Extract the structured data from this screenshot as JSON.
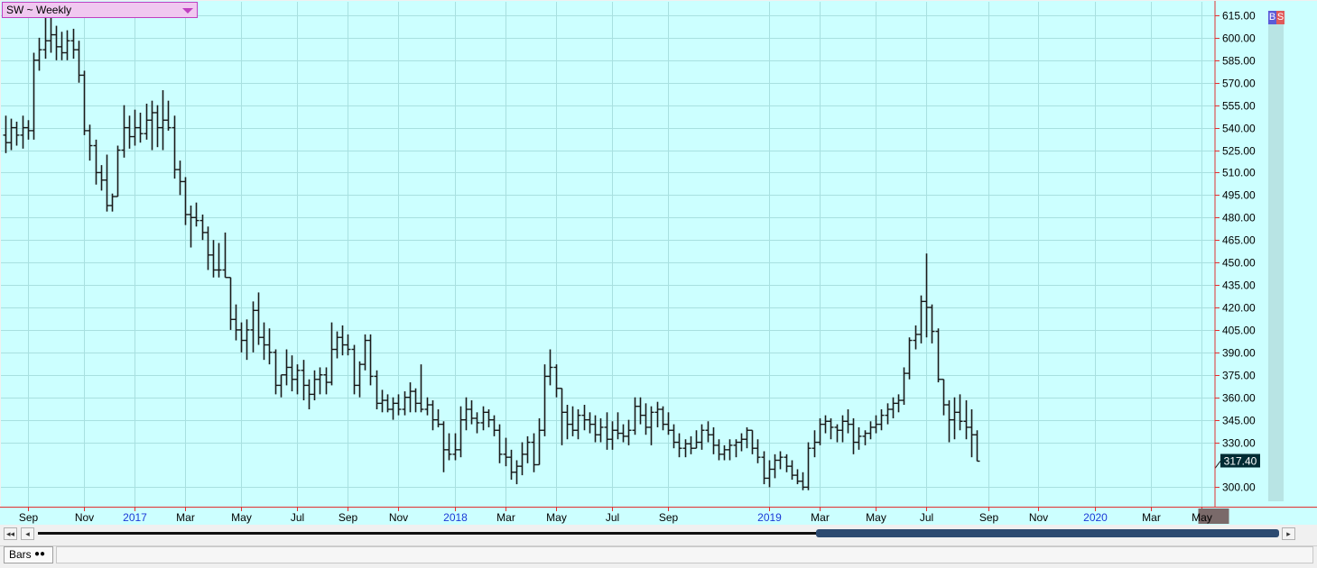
{
  "header": {
    "symbol_label": "SW ~ Weekly"
  },
  "buttons": {
    "buy": "B",
    "sell": "S"
  },
  "status": {
    "chart_style": "Bars",
    "style_icon": "●●"
  },
  "nav": {
    "first": "◂◂",
    "prev": "◂",
    "next": "▸"
  },
  "colors": {
    "background": "#ccffff",
    "grid": "#a8e0e0",
    "bar": "#1a1a1a",
    "axis": "#e03030",
    "last_box": "#002b33"
  },
  "chart_data": {
    "type": "ohlc",
    "title": "SW ~ Weekly",
    "xlabel": "",
    "ylabel": "",
    "ylim": [
      287,
      624
    ],
    "grid": true,
    "y_ticks": [
      "615.00",
      "600.00",
      "585.00",
      "570.00",
      "555.00",
      "540.00",
      "525.00",
      "510.00",
      "495.00",
      "480.00",
      "465.00",
      "450.00",
      "435.00",
      "420.00",
      "405.00",
      "390.00",
      "375.00",
      "360.00",
      "345.00",
      "330.00",
      "300.00"
    ],
    "last_price": "317.40",
    "x_ticks": [
      {
        "i": 4,
        "label": "Sep",
        "year": false
      },
      {
        "i": 14,
        "label": "Nov",
        "year": false
      },
      {
        "i": 23,
        "label": "2017",
        "year": true
      },
      {
        "i": 32,
        "label": "Mar",
        "year": false
      },
      {
        "i": 42,
        "label": "May",
        "year": false
      },
      {
        "i": 52,
        "label": "Jul",
        "year": false
      },
      {
        "i": 61,
        "label": "Sep",
        "year": false
      },
      {
        "i": 70,
        "label": "Nov",
        "year": false
      },
      {
        "i": 80,
        "label": "2018",
        "year": true
      },
      {
        "i": 89,
        "label": "Mar",
        "year": false
      },
      {
        "i": 98,
        "label": "May",
        "year": false
      },
      {
        "i": 108,
        "label": "Jul",
        "year": false
      },
      {
        "i": 118,
        "label": "Sep",
        "year": false
      },
      {
        "i": 136,
        "label": "2019",
        "year": true
      },
      {
        "i": 145,
        "label": "Mar",
        "year": false
      },
      {
        "i": 155,
        "label": "May",
        "year": false
      },
      {
        "i": 164,
        "label": "Jul",
        "year": false
      },
      {
        "i": 175,
        "label": "Sep",
        "year": false
      },
      {
        "i": 184,
        "label": "Nov",
        "year": false
      },
      {
        "i": 194,
        "label": "2020",
        "year": true
      },
      {
        "i": 204,
        "label": "Mar",
        "year": false
      },
      {
        "i": 213,
        "label": "May",
        "year": false,
        "highlight": true
      }
    ],
    "bars": [
      [
        535,
        548,
        523,
        530
      ],
      [
        530,
        546,
        525,
        540
      ],
      [
        540,
        544,
        528,
        535
      ],
      [
        535,
        548,
        526,
        540
      ],
      [
        540,
        545,
        532,
        538
      ],
      [
        538,
        590,
        532,
        585
      ],
      [
        585,
        600,
        578,
        592
      ],
      [
        592,
        616,
        586,
        598
      ],
      [
        598,
        624,
        590,
        602
      ],
      [
        602,
        608,
        585,
        594
      ],
      [
        594,
        604,
        585,
        590
      ],
      [
        590,
        605,
        585,
        598
      ],
      [
        598,
        606,
        586,
        592
      ],
      [
        592,
        598,
        570,
        575
      ],
      [
        575,
        578,
        535,
        538
      ],
      [
        538,
        542,
        518,
        528
      ],
      [
        528,
        532,
        502,
        510
      ],
      [
        510,
        515,
        498,
        505
      ],
      [
        505,
        522,
        484,
        488
      ],
      [
        488,
        496,
        484,
        494
      ],
      [
        494,
        528,
        496,
        525
      ],
      [
        525,
        555,
        520,
        540
      ],
      [
        540,
        548,
        526,
        534
      ],
      [
        534,
        552,
        528,
        540
      ],
      [
        540,
        550,
        530,
        536
      ],
      [
        536,
        556,
        532,
        545
      ],
      [
        545,
        558,
        525,
        550
      ],
      [
        550,
        555,
        527,
        540
      ],
      [
        540,
        565,
        525,
        545
      ],
      [
        545,
        558,
        538,
        540
      ],
      [
        540,
        548,
        506,
        512
      ],
      [
        512,
        518,
        495,
        504
      ],
      [
        504,
        507,
        475,
        482
      ],
      [
        482,
        488,
        460,
        480
      ],
      [
        480,
        490,
        474,
        478
      ],
      [
        478,
        482,
        465,
        470
      ],
      [
        470,
        474,
        445,
        455
      ],
      [
        455,
        465,
        440,
        445
      ],
      [
        445,
        463,
        440,
        445
      ],
      [
        445,
        470,
        444,
        440
      ],
      [
        440,
        440,
        405,
        412
      ],
      [
        412,
        422,
        398,
        405
      ],
      [
        405,
        410,
        390,
        398
      ],
      [
        398,
        412,
        385,
        405
      ],
      [
        405,
        424,
        390,
        418
      ],
      [
        418,
        430,
        395,
        400
      ],
      [
        400,
        410,
        385,
        395
      ],
      [
        395,
        406,
        382,
        390
      ],
      [
        390,
        392,
        362,
        368
      ],
      [
        368,
        372,
        360,
        375
      ],
      [
        375,
        392,
        368,
        380
      ],
      [
        380,
        388,
        364,
        372
      ],
      [
        372,
        382,
        362,
        378
      ],
      [
        378,
        385,
        358,
        368
      ],
      [
        368,
        372,
        352,
        362
      ],
      [
        362,
        378,
        358,
        372
      ],
      [
        372,
        380,
        362,
        375
      ],
      [
        375,
        380,
        362,
        370
      ],
      [
        370,
        410,
        368,
        392
      ],
      [
        392,
        404,
        386,
        400
      ],
      [
        400,
        408,
        388,
        395
      ],
      [
        395,
        402,
        388,
        392
      ],
      [
        392,
        395,
        362,
        368
      ],
      [
        368,
        384,
        360,
        382
      ],
      [
        382,
        402,
        378,
        398
      ],
      [
        398,
        402,
        368,
        374
      ],
      [
        374,
        378,
        352,
        356
      ],
      [
        356,
        365,
        350,
        358
      ],
      [
        358,
        362,
        350,
        352
      ],
      [
        352,
        360,
        345,
        356
      ],
      [
        356,
        362,
        348,
        352
      ],
      [
        352,
        364,
        348,
        360
      ],
      [
        360,
        370,
        350,
        364
      ],
      [
        364,
        366,
        350,
        356
      ],
      [
        356,
        382,
        350,
        352
      ],
      [
        352,
        360,
        348,
        355
      ],
      [
        355,
        358,
        338,
        345
      ],
      [
        345,
        352,
        340,
        342
      ],
      [
        342,
        344,
        310,
        325
      ],
      [
        325,
        336,
        318,
        322
      ],
      [
        322,
        336,
        318,
        325
      ],
      [
        325,
        354,
        320,
        345
      ],
      [
        345,
        360,
        338,
        352
      ],
      [
        352,
        358,
        342,
        346
      ],
      [
        346,
        350,
        336,
        343
      ],
      [
        343,
        354,
        338,
        350
      ],
      [
        350,
        352,
        340,
        345
      ],
      [
        345,
        348,
        334,
        338
      ],
      [
        338,
        342,
        316,
        322
      ],
      [
        322,
        333,
        314,
        320
      ],
      [
        320,
        325,
        305,
        310
      ],
      [
        310,
        318,
        302,
        314
      ],
      [
        314,
        330,
        308,
        322
      ],
      [
        322,
        334,
        316,
        330
      ],
      [
        330,
        336,
        310,
        315
      ],
      [
        315,
        346,
        320,
        338
      ],
      [
        338,
        382,
        334,
        374
      ],
      [
        374,
        392,
        368,
        380
      ],
      [
        380,
        382,
        360,
        366
      ],
      [
        366,
        360,
        328,
        350
      ],
      [
        350,
        355,
        332,
        342
      ],
      [
        342,
        354,
        334,
        338
      ],
      [
        338,
        352,
        332,
        348
      ],
      [
        348,
        355,
        338,
        345
      ],
      [
        345,
        350,
        336,
        342
      ],
      [
        342,
        348,
        330,
        335
      ],
      [
        335,
        346,
        330,
        340
      ],
      [
        340,
        350,
        325,
        332
      ],
      [
        332,
        344,
        325,
        338
      ],
      [
        338,
        350,
        332,
        336
      ],
      [
        336,
        342,
        330,
        334
      ],
      [
        334,
        345,
        328,
        338
      ],
      [
        338,
        360,
        335,
        354
      ],
      [
        354,
        360,
        342,
        348
      ],
      [
        348,
        356,
        335,
        340
      ],
      [
        340,
        354,
        328,
        350
      ],
      [
        350,
        357,
        340,
        352
      ],
      [
        352,
        354,
        338,
        342
      ],
      [
        342,
        350,
        335,
        338
      ],
      [
        338,
        342,
        326,
        330
      ],
      [
        330,
        336,
        320,
        326
      ],
      [
        326,
        332,
        320,
        329
      ],
      [
        329,
        334,
        322,
        326
      ],
      [
        326,
        338,
        328,
        330
      ],
      [
        330,
        342,
        325,
        338
      ],
      [
        338,
        344,
        330,
        335
      ],
      [
        335,
        340,
        322,
        328
      ],
      [
        328,
        332,
        318,
        322
      ],
      [
        322,
        328,
        318,
        325
      ],
      [
        325,
        332,
        318,
        328
      ],
      [
        328,
        332,
        320,
        330
      ],
      [
        330,
        336,
        324,
        332
      ],
      [
        332,
        340,
        326,
        338
      ],
      [
        338,
        338,
        322,
        326
      ],
      [
        326,
        332,
        316,
        320
      ],
      [
        320,
        324,
        302,
        306
      ],
      [
        306,
        318,
        300,
        312
      ],
      [
        312,
        322,
        306,
        318
      ],
      [
        318,
        324,
        312,
        320
      ],
      [
        320,
        322,
        310,
        314
      ],
      [
        314,
        318,
        305,
        308
      ],
      [
        308,
        312,
        302,
        304
      ],
      [
        304,
        310,
        298,
        300
      ],
      [
        300,
        330,
        298,
        326
      ],
      [
        326,
        338,
        320,
        330
      ],
      [
        330,
        346,
        328,
        342
      ],
      [
        342,
        348,
        336,
        344
      ],
      [
        344,
        346,
        332,
        340
      ],
      [
        340,
        342,
        330,
        338
      ],
      [
        338,
        348,
        330,
        344
      ],
      [
        344,
        352,
        336,
        342
      ],
      [
        342,
        346,
        322,
        330
      ],
      [
        330,
        340,
        325,
        334
      ],
      [
        334,
        338,
        328,
        336
      ],
      [
        336,
        344,
        332,
        340
      ],
      [
        340,
        348,
        336,
        342
      ],
      [
        342,
        352,
        338,
        348
      ],
      [
        348,
        356,
        342,
        352
      ],
      [
        352,
        360,
        346,
        356
      ],
      [
        356,
        362,
        350,
        358
      ],
      [
        358,
        380,
        355,
        376
      ],
      [
        376,
        400,
        372,
        398
      ],
      [
        398,
        408,
        392,
        402
      ],
      [
        402,
        428,
        396,
        424
      ],
      [
        424,
        456,
        400,
        420
      ],
      [
        420,
        422,
        396,
        404
      ],
      [
        404,
        406,
        370,
        372
      ],
      [
        372,
        366,
        348,
        355
      ],
      [
        355,
        358,
        330,
        345
      ],
      [
        345,
        360,
        332,
        350
      ],
      [
        350,
        362,
        338,
        344
      ],
      [
        344,
        358,
        332,
        340
      ],
      [
        340,
        352,
        320,
        335
      ],
      [
        335,
        338,
        318,
        317.4
      ]
    ]
  }
}
